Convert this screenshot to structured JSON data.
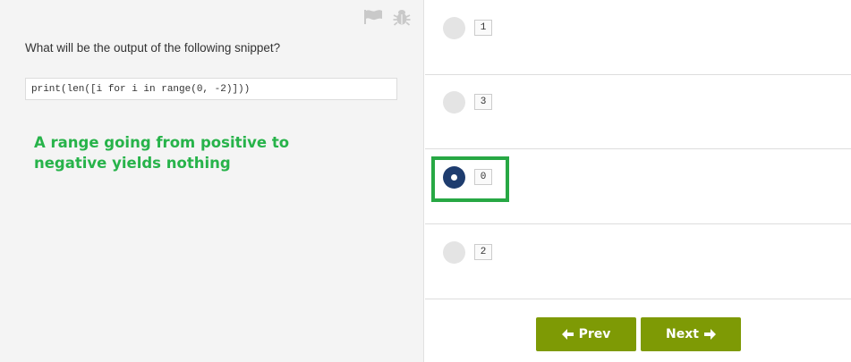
{
  "question": {
    "text": "What will be the output of the following snippet?",
    "code": "print(len([i for i in range(0, -2)]))"
  },
  "annotation": {
    "text": "A range going from positive to negative yields nothing",
    "color": "#27b34a"
  },
  "toolbar_icons": [
    "flag-icon",
    "bug-icon"
  ],
  "options": [
    {
      "label": "1",
      "selected": false
    },
    {
      "label": "3",
      "selected": false
    },
    {
      "label": "0",
      "selected": true
    },
    {
      "label": "2",
      "selected": false
    }
  ],
  "navigation": {
    "prev_label": "Prev",
    "next_label": "Next",
    "button_color": "#7e9a05"
  },
  "colors": {
    "selected_radio": "#1e3c6e",
    "highlight_box": "#27a844",
    "left_panel_bg": "#f4f4f4"
  }
}
